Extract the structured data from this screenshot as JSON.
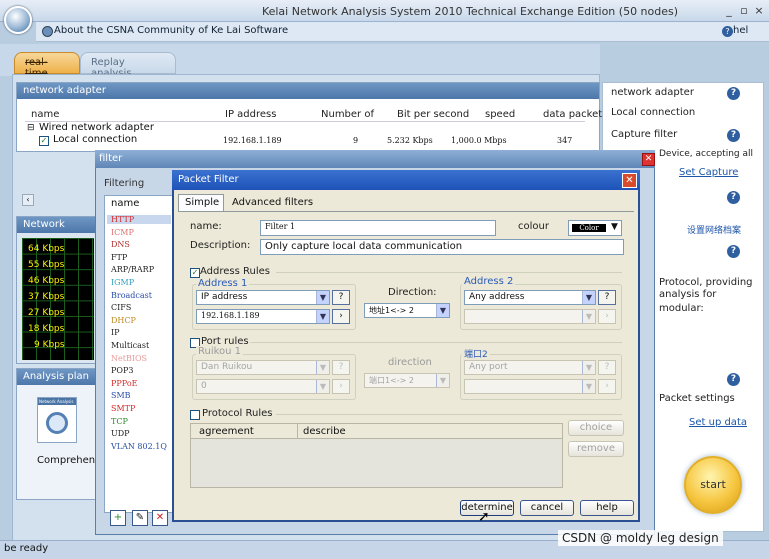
{
  "app": {
    "title": "Kelai Network Analysis System 2010 Technical Exchange Edition (50 nodes)",
    "about_link": "About the CSNA Community of Ke Lai Software",
    "help_label": "hel",
    "window_buttons": [
      "_",
      "▫",
      "×"
    ]
  },
  "tabs": [
    {
      "label": "real-time",
      "active": true
    },
    {
      "label": "Replay analysis",
      "active": false
    }
  ],
  "network_adapter_panel": {
    "title": "network adapter",
    "columns": [
      "name",
      "IP address",
      "Number of",
      "Bit per second",
      "speed",
      "data packet"
    ],
    "group_label": "Wired network adapter",
    "row": {
      "name": "Local connection",
      "ip": "192.168.1.189",
      "num": "9",
      "bps": "5.232 Kbps",
      "speed": "1,000.0 Mbps",
      "packets": "347"
    }
  },
  "traffic_panel": {
    "title": "Network",
    "labels": [
      "64 Kbps",
      "55 Kbps",
      "46 Kbps",
      "37 Kbps",
      "27 Kbps",
      "18 Kbps",
      "9 Kbps"
    ]
  },
  "analysis_plan": {
    "title": "Analysis plan",
    "item_label": "Network Analysis",
    "comprehensive": "Comprehensive analysis"
  },
  "right_panel": {
    "network_adapter": "network adapter",
    "local_connection": "Local connection",
    "capture_filter": "Capture filter",
    "capture_desc": "Device, accepting all",
    "set_capture": "Set Capture",
    "network_profile": "设置网络档案",
    "protocol_desc": "Protocol, providing",
    "analysis_for": "analysis for",
    "modular": "modular:",
    "packet_settings": "Packet settings",
    "set_up_data": "Set up data"
  },
  "start_button": "start",
  "filter_dialog": {
    "title": "filter",
    "subtitle": "Filtering",
    "list_header": "name",
    "protocols": [
      "HTTP",
      "ICMP",
      "DNS",
      "FTP",
      "ARP/RARP",
      "IGMP",
      "Broadcast",
      "CIFS",
      "DHCP",
      "IP",
      "Multicast",
      "NetBIOS",
      "POP3",
      "PPPoE",
      "SMB",
      "SMTP",
      "TCP",
      "UDP",
      "VLAN 802.1Q"
    ],
    "protocol_colors": [
      "#d42a2a",
      "#e07070",
      "#b03030",
      "#222222",
      "#222222",
      "#30a0c0",
      "#2a4fa8",
      "#222222",
      "#c08a20",
      "#222222",
      "#222222",
      "#e89a9a",
      "#222222",
      "#d42a2a",
      "#2a4fa8",
      "#d42a2a",
      "#2a8a2a",
      "#222222",
      "#2a4fa8"
    ]
  },
  "packet_filter": {
    "title": "Packet Filter",
    "tabs": [
      "Simple",
      "Advanced filters"
    ],
    "name_label": "name:",
    "name_value": "Filter 1",
    "colour_label": "colour",
    "colour_value": "Color",
    "description_label": "Description:",
    "description_value": "Only capture local data communication",
    "address_rules": {
      "label": "Address Rules",
      "checked": true,
      "address1": "Address 1",
      "address2": "Address 2",
      "type1": "IP address",
      "value1": "192.168.1.189",
      "direction_label": "Direction:",
      "direction_value": "地址1<-> 2",
      "type2": "Any address"
    },
    "port_rules": {
      "label": "Port rules",
      "checked": false,
      "port1": "Ruikou 1",
      "port2": "端口2",
      "type1": "Dan Ruikou",
      "value1": "0",
      "direction_label": "direction",
      "direction_value": "端口1<-> 2",
      "type2": "Any port"
    },
    "protocol_rules": {
      "label": "Protocol Rules",
      "checked": false,
      "col_agreement": "agreement",
      "col_describe": "describe",
      "choice": "choice",
      "remove": "remove"
    },
    "buttons": {
      "ok": "determine",
      "cancel": "cancel",
      "help": "help"
    }
  },
  "status": "be ready",
  "watermark": "CSDN @ moldy leg design"
}
